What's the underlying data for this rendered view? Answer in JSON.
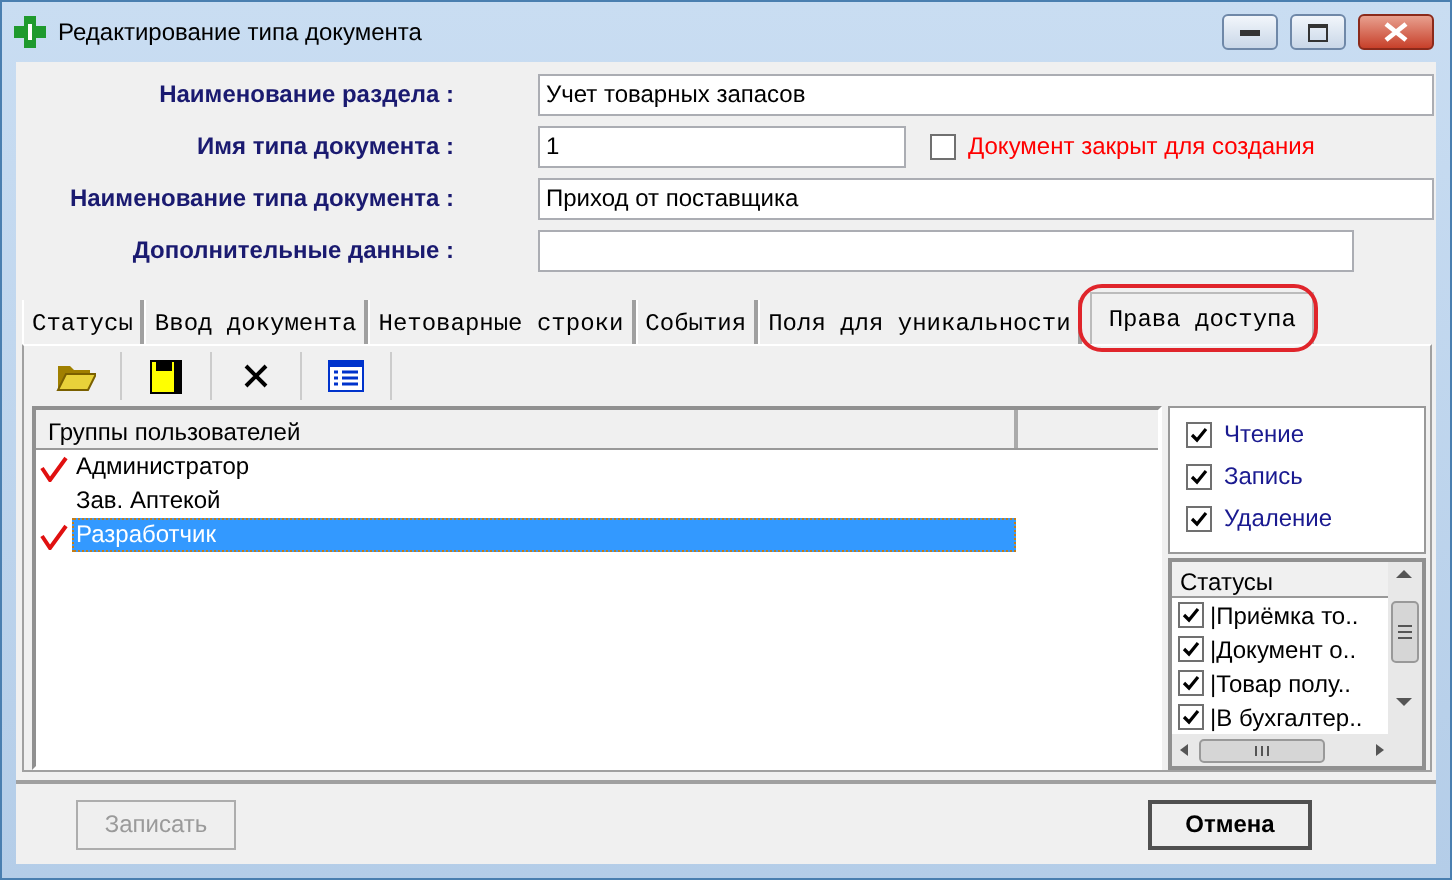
{
  "window": {
    "title": "Редактирование типа документа"
  },
  "fields": [
    {
      "label": "Наименование раздела :",
      "value": "Учет товарных запасов"
    },
    {
      "label": "Имя типа документа :",
      "value": "1"
    },
    {
      "label": "Наименование типа документа :",
      "value": "Приход от поставщика"
    },
    {
      "label": "Дополнительные данные :"
    }
  ],
  "closed_checkbox": {
    "label": "Документ закрыт для создания",
    "checked": false
  },
  "tabs": [
    {
      "label": "Статусы",
      "selected": false
    },
    {
      "label": "Ввод документа",
      "selected": false
    },
    {
      "label": "Нетоварные строки",
      "selected": false
    },
    {
      "label": "События",
      "selected": false
    },
    {
      "label": "Поля для уникальности",
      "selected": false
    },
    {
      "label": "Права доступа",
      "selected": true
    }
  ],
  "groups_table": {
    "columns": [
      "Группы пользователей"
    ],
    "rows": [
      {
        "name": "Администратор",
        "granted": true,
        "selected": false
      },
      {
        "name": "Зав. Аптекой",
        "granted": false,
        "selected": false
      },
      {
        "name": "Разработчик",
        "granted": true,
        "selected": true
      }
    ]
  },
  "permissions": [
    {
      "label": "Чтение",
      "checked": true
    },
    {
      "label": "Запись",
      "checked": true
    },
    {
      "label": "Удаление",
      "checked": true
    }
  ],
  "statuses": {
    "header": "Статусы",
    "items": [
      {
        "label": "|Приёмка то..",
        "checked": true
      },
      {
        "label": "|Документ о..",
        "checked": true
      },
      {
        "label": "|Товар полу..",
        "checked": true
      },
      {
        "label": "|В бухгалтер..",
        "checked": true
      }
    ]
  },
  "buttons": [
    {
      "label": "Записать",
      "disabled": true,
      "default": false
    },
    {
      "label": "Отмена",
      "disabled": false,
      "default": true
    }
  ]
}
